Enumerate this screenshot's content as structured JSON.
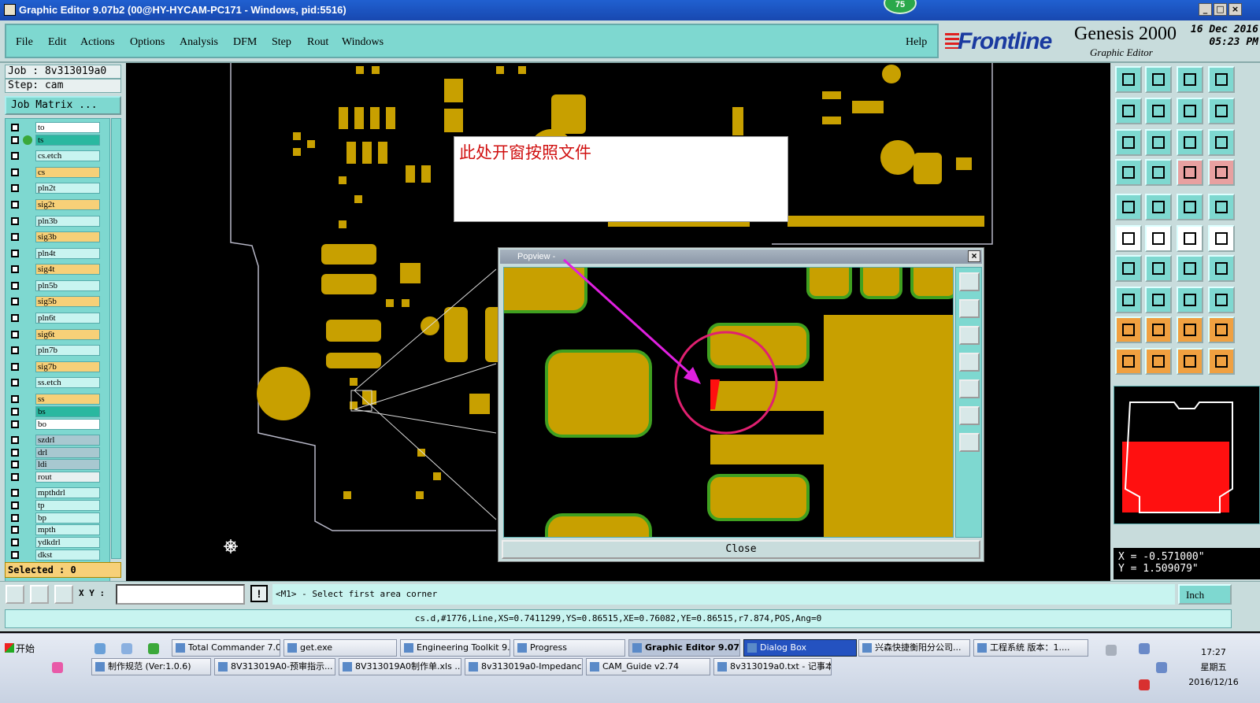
{
  "window": {
    "title": "Graphic Editor 9.07b2 (00@HY-HYCAM-PC171 - Windows, pid:5516)",
    "notification_badge": "75"
  },
  "menu": {
    "items": [
      "File",
      "Edit",
      "Actions",
      "Options",
      "Analysis",
      "DFM",
      "Step",
      "Rout",
      "Windows"
    ],
    "help": "Help"
  },
  "brand": {
    "logo": "Frontline",
    "product": "Genesis 2000",
    "subtitle": "Graphic Editor",
    "date": "16 Dec 2016",
    "time": "05:23 PM"
  },
  "job": {
    "job_line": "Job : 8v313019a0",
    "step_line": "Step: cam",
    "matrix_button": "Job Matrix ..."
  },
  "layers": [
    {
      "name": "to",
      "color": "#ffffff",
      "marked": true
    },
    {
      "name": "ts",
      "color": "#2ab8a0",
      "marked": true
    },
    {
      "name": "cs.etch",
      "color": "#c8f4f0",
      "marked": false
    },
    {
      "name": "cs",
      "color": "#f7d078",
      "marked": false
    },
    {
      "name": "pln2t",
      "color": "#c8f4f0",
      "marked": false
    },
    {
      "name": "sig2t",
      "color": "#f7d078",
      "marked": false
    },
    {
      "name": "pln3b",
      "color": "#c8f4f0",
      "marked": false
    },
    {
      "name": "sig3b",
      "color": "#f7d078",
      "marked": false
    },
    {
      "name": "pln4t",
      "color": "#c8f4f0",
      "marked": false
    },
    {
      "name": "sig4t",
      "color": "#f7d078",
      "marked": false
    },
    {
      "name": "pln5b",
      "color": "#c8f4f0",
      "marked": false
    },
    {
      "name": "sig5b",
      "color": "#f7d078",
      "marked": false
    },
    {
      "name": "pln6t",
      "color": "#c8f4f0",
      "marked": false
    },
    {
      "name": "sig6t",
      "color": "#f7d078",
      "marked": false
    },
    {
      "name": "pln7b",
      "color": "#c8f4f0",
      "marked": false
    },
    {
      "name": "sig7b",
      "color": "#f7d078",
      "marked": false
    },
    {
      "name": "ss.etch",
      "color": "#c8f4f0",
      "marked": false
    },
    {
      "name": "ss",
      "color": "#f7d078",
      "marked": false
    },
    {
      "name": "bs",
      "color": "#2ab8a0",
      "marked": false
    },
    {
      "name": "bo",
      "color": "#ffffff",
      "marked": true
    },
    {
      "name": "szdrl",
      "color": "#a8c8d0",
      "marked": false
    },
    {
      "name": "drl",
      "color": "#a8c8d0",
      "marked": false
    },
    {
      "name": "ldi",
      "color": "#a8c8d0",
      "marked": false
    },
    {
      "name": "rout",
      "color": "#e8f0f0",
      "marked": false
    },
    {
      "name": "mpthdrl",
      "color": "#c8f4f0",
      "marked": false
    },
    {
      "name": "tp",
      "color": "#c8f4f0",
      "marked": false
    },
    {
      "name": "bp",
      "color": "#c8f4f0",
      "marked": false
    },
    {
      "name": "mpth",
      "color": "#c8f4f0",
      "marked": false
    },
    {
      "name": "ydkdrl",
      "color": "#c8f4f0",
      "marked": false
    },
    {
      "name": "dkst",
      "color": "#c8f4f0",
      "marked": false
    }
  ],
  "selected_count": "Selected : 0",
  "annotation": {
    "text": "此处开窗按照文件"
  },
  "popview": {
    "title": "Popview - ",
    "close_button": "Close"
  },
  "coords": {
    "x_line": "X = -0.571000\"",
    "y_line": "Y =  1.509079\""
  },
  "command": {
    "xy_label": "X Y :",
    "xy_value": "",
    "prompt": "<M1> - Select first area corner",
    "units": "Inch"
  },
  "status": {
    "text": "cs.d,#1776,Line,XS=0.7411299,YS=0.86515,XE=0.76082,YE=0.86515,r7.874,POS,Ang=0"
  },
  "taskbar": {
    "start": "开始",
    "row1": [
      {
        "label": "Total Commander 7.0 ...",
        "state": "normal"
      },
      {
        "label": "get.exe",
        "state": "normal"
      },
      {
        "label": "Engineering Toolkit 9....",
        "state": "normal"
      },
      {
        "label": "Progress",
        "state": "normal"
      },
      {
        "label": "Graphic Editor 9.07...",
        "state": "pressed"
      },
      {
        "label": "Dialog Box",
        "state": "active"
      },
      {
        "label": "兴森快捷衡阳分公司...",
        "state": "normal"
      },
      {
        "label": "工程系统  版本：1....",
        "state": "normal"
      }
    ],
    "row2": [
      {
        "label": "制作规范 (Ver:1.0.6)",
        "state": "normal"
      },
      {
        "label": "8V313019A0-预审指示...",
        "state": "normal"
      },
      {
        "label": "8V313019A0制作单.xls ...",
        "state": "normal"
      },
      {
        "label": "8v313019a0-Impedance ...",
        "state": "normal"
      },
      {
        "label": "CAM_Guide v2.74",
        "state": "normal"
      },
      {
        "label": "8v313019a0.txt - 记事本",
        "state": "normal"
      }
    ],
    "clock_time": "17:27",
    "clock_day": "星期五",
    "clock_date": "2016/12/16"
  }
}
